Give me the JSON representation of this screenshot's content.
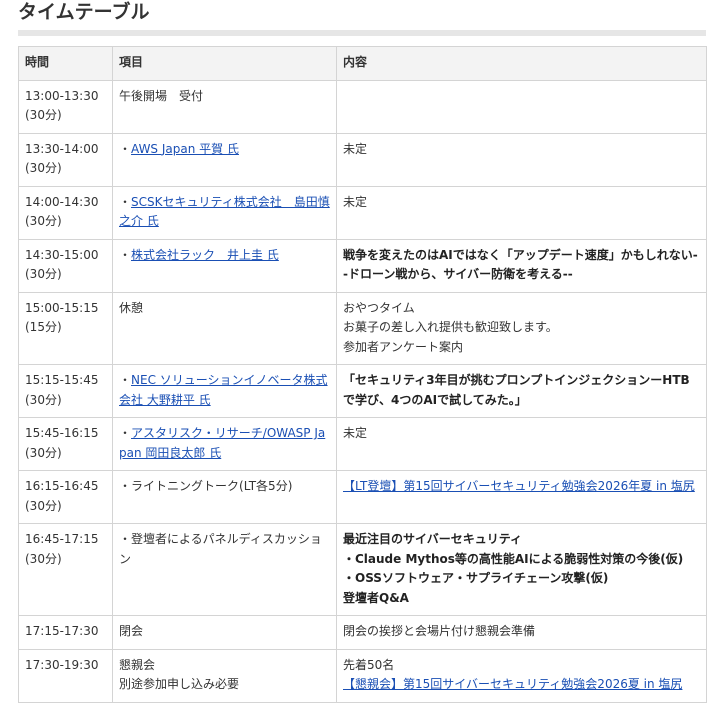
{
  "page": {
    "title": "タイムテーブル"
  },
  "table": {
    "headers": [
      "時間",
      "項目",
      "内容"
    ],
    "rows": [
      {
        "time": "13:00-13:30",
        "duration": "(30分)",
        "item": "午後開場　受付",
        "item_link": false,
        "content": []
      },
      {
        "time": "13:30-14:00",
        "duration": "(30分)",
        "item": "AWS Japan 平賀 氏",
        "item_link": true,
        "content": [
          {
            "text": "未定"
          }
        ]
      },
      {
        "time": "14:00-14:30",
        "duration": "(30分)",
        "item": "SCSKセキュリティ株式会社　島田慎之介 氏",
        "item_link": true,
        "content": [
          {
            "text": "未定"
          }
        ]
      },
      {
        "time": "14:30-15:00",
        "duration": "(30分)",
        "item": "株式会社ラック　井上圭 氏",
        "item_link": true,
        "content": [
          {
            "text": "戦争を変えたのはAIではなく「アップデート速度」かもしれない--ドローン戦から、サイバー防衛を考える--",
            "bold": true
          }
        ]
      },
      {
        "time": "15:00-15:15",
        "duration": "(15分)",
        "item": "休憩",
        "item_link": false,
        "content": [
          {
            "text": "おやつタイム"
          },
          {
            "text": "お菓子の差し入れ提供も歓迎致します。"
          },
          {
            "text": "参加者アンケート案内"
          }
        ]
      },
      {
        "time": "15:15-15:45",
        "duration": "(30分)",
        "item": "NEC ソリューションイノベータ株式会社 大野耕平 氏",
        "item_link": true,
        "content": [
          {
            "text": "「セキュリティ3年目が挑むプロンプトインジェクションーHTBで学び、4つのAIで試してみた。」",
            "bold": true
          }
        ]
      },
      {
        "time": "15:45-16:15",
        "duration": "(30分)",
        "item": "アスタリスク・リサーチ/OWASP Japan 岡田良太郎 氏",
        "item_link": true,
        "content": [
          {
            "text": "未定"
          }
        ]
      },
      {
        "time": "16:15-16:45",
        "duration": "(30分)",
        "item": "ライトニングトーク(LT各5分)",
        "item_link": false,
        "content": [
          {
            "text": "【LT登壇】第15回サイバーセキュリティ勉強会2026年夏 in 塩尻",
            "link": true
          }
        ]
      },
      {
        "time": "16:45-17:15",
        "duration": "(30分)",
        "item": "登壇者によるパネルディスカッション",
        "item_link": false,
        "content": [
          {
            "text": "最近注目のサイバーセキュリティ",
            "bold": true
          },
          {
            "text": "・Claude Mythos等の高性能AIによる脆弱性対策の今後(仮)",
            "bold": true
          },
          {
            "text": "・OSSソフトウェア・サプライチェーン攻撃(仮)",
            "bold": true
          },
          {
            "text": "登壇者Q&A",
            "bold": true
          }
        ]
      },
      {
        "time": "17:15-17:30",
        "duration": "",
        "item": "閉会",
        "item_link": false,
        "content": [
          {
            "text": "閉会の挨拶と会場片付け懇親会準備"
          }
        ]
      },
      {
        "time": "17:30-19:30",
        "duration": "",
        "item": "懇親会",
        "item_sub": "別途参加申し込み必要",
        "item_link": false,
        "content": [
          {
            "text": "先着50名"
          },
          {
            "text": "【懇親会】第15回サイバーセキュリティ勉強会2026夏 in 塩尻",
            "link": true
          }
        ]
      }
    ]
  }
}
